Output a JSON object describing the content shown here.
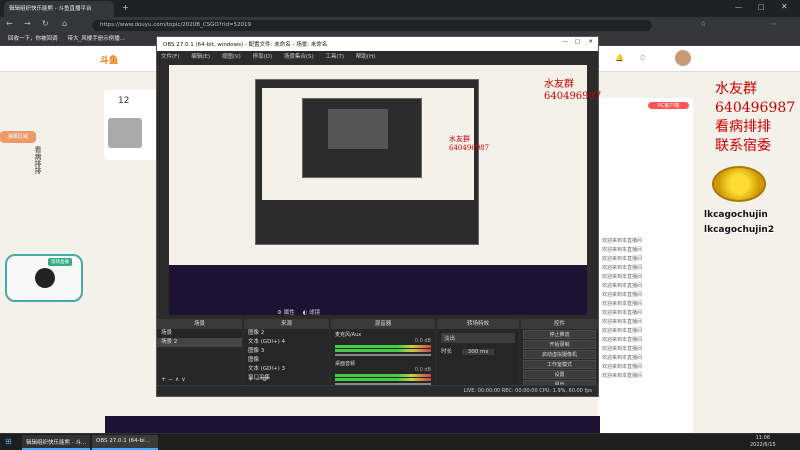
{
  "browser": {
    "tab_title": "辑辑组织快乐能熊 - 斗鱼直播平台",
    "url": "https://www.douyu.com/topic/2020B_CSGO?rid=52019",
    "bookmarks": [
      "回收一下，你被回调",
      "带大_风楼手册示例播..."
    ]
  },
  "webpage": {
    "logo": "斗鱼",
    "viewer_count": "12",
    "right_panel": {
      "tag": "PC客户端",
      "chat_lines": [
        "欢迎来到本直播间",
        "欢迎来到本直播间",
        "欢迎来到本直播间",
        "欢迎来到本直播间",
        "欢迎来到本直播间",
        "欢迎来到本直播间",
        "欢迎来到本直播间",
        "欢迎来到本直播间",
        "欢迎来到本直播间",
        "欢迎来到本直播间",
        "欢迎来到本直播间",
        "欢迎来到本直播间",
        "欢迎来到本直播间",
        "欢迎来到本直播间",
        "欢迎来到本直播间",
        "欢迎来到本直播间"
      ]
    },
    "overlay": {
      "line1": "水友群",
      "line2": "640496987",
      "line3": "看病排排",
      "line4": "联系宿委",
      "name1": "lkcagochujin",
      "name2": "lkcagochujin2"
    },
    "left_tag": "弹幕区域",
    "cat_badge": "现场直播"
  },
  "obs": {
    "title": "OBS 27.0.1 (64-bit, windows) - 配置文件: 未命名 - 场景: 未命名",
    "menu": [
      "文件(F)",
      "编辑(E)",
      "视图(V)",
      "停靠(D)",
      "场景集合(S)",
      "工具(T)",
      "帮助(H)"
    ],
    "docks": {
      "scenes_title": "场景",
      "scenes": [
        "场景",
        "场景 2"
      ],
      "sources_title": "来源",
      "sources": [
        "图像 2",
        "文本 (GDI+) 4",
        "图像 3",
        "图像",
        "文本 (GDI+) 3",
        "窗口采集"
      ],
      "mixer_title": "混音器",
      "mixer_channels": [
        {
          "name": "麦克风/Aux",
          "db": "0.0 dB"
        },
        {
          "name": "桌面音频",
          "db": "0.0 dB"
        }
      ],
      "transition_title": "转场特效",
      "transition_value": "淡出",
      "duration_label": "时长",
      "duration_value": "300 ms",
      "controls_title": "控件",
      "controls": [
        "停止推流",
        "开始录制",
        "启动虚拟摄像机",
        "工作室模式",
        "设置",
        "退出"
      ]
    },
    "status": "LIVE: 00:00:00  REC: 00:00:00  CPU: 1.9%, 60.00 fps",
    "scene_toolbar": [
      "属性",
      "滤镜"
    ]
  },
  "taskbar": {
    "items": [
      "辑辑组织快乐能熊 - 斗...",
      "OBS 27.0.1 (64-bi..."
    ],
    "time": "11:06",
    "date": "2022/6/15"
  },
  "colors": {
    "accent": "#ff6a00",
    "obs_bg": "#2b2b2b",
    "overlay_red": "#cc0000"
  }
}
